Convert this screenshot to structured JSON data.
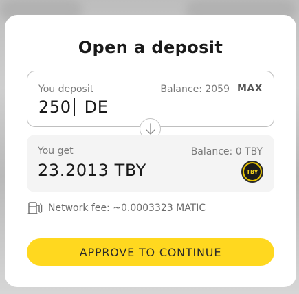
{
  "modal": {
    "title": "Open a deposit"
  },
  "deposit": {
    "label": "You deposit",
    "balance_text": "Balance: 2059",
    "max_label": "MAX",
    "amount": "250",
    "unit": "DE"
  },
  "receive": {
    "label": "You get",
    "balance_text": "Balance: 0 TBY",
    "amount": "23.2013 TBY",
    "token_symbol": "TBY"
  },
  "fee": {
    "text": "Network fee: ~0.0003323 MATIC"
  },
  "action": {
    "approve_label": "APPROVE TO CONTINUE"
  },
  "colors": {
    "accent": "#ffd81f",
    "token": "#e6c200"
  },
  "icons": {
    "swap_direction": "arrow-down-icon",
    "fee": "fuel-pump-icon"
  }
}
